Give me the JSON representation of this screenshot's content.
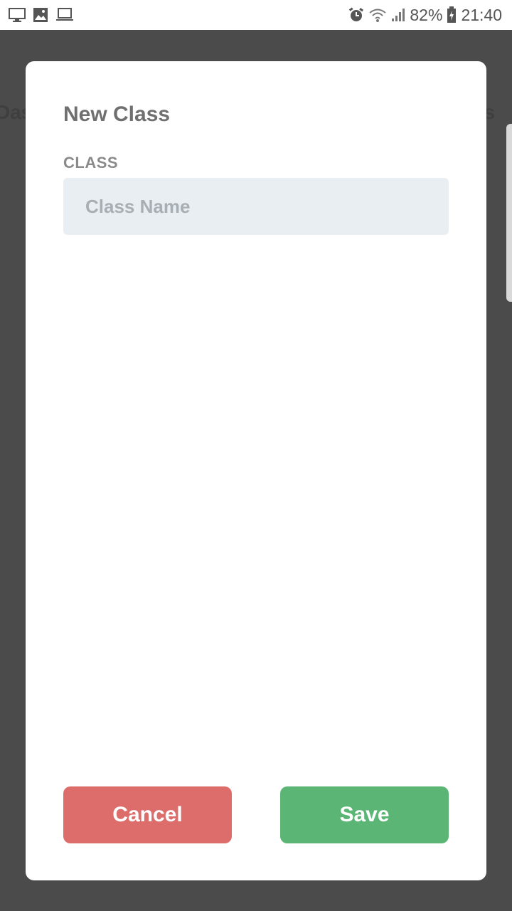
{
  "status_bar": {
    "left_icons": [
      "monitor-icon",
      "image-icon",
      "laptop-icon"
    ],
    "right_icons": [
      "alarm-icon",
      "wifi-icon",
      "signal-icon",
      "battery-icon"
    ],
    "battery": "82%",
    "time": "21:40"
  },
  "background": {
    "title_left": "Das",
    "title_right": "s"
  },
  "modal": {
    "title": "New Class",
    "field_label": "CLASS",
    "input_placeholder": "Class Name",
    "input_value": "",
    "cancel_label": "Cancel",
    "save_label": "Save"
  },
  "colors": {
    "cancel": "#dd6d6b",
    "save": "#5bb675",
    "input_bg": "#e9eef2",
    "overlay": "#4b4b4b"
  }
}
